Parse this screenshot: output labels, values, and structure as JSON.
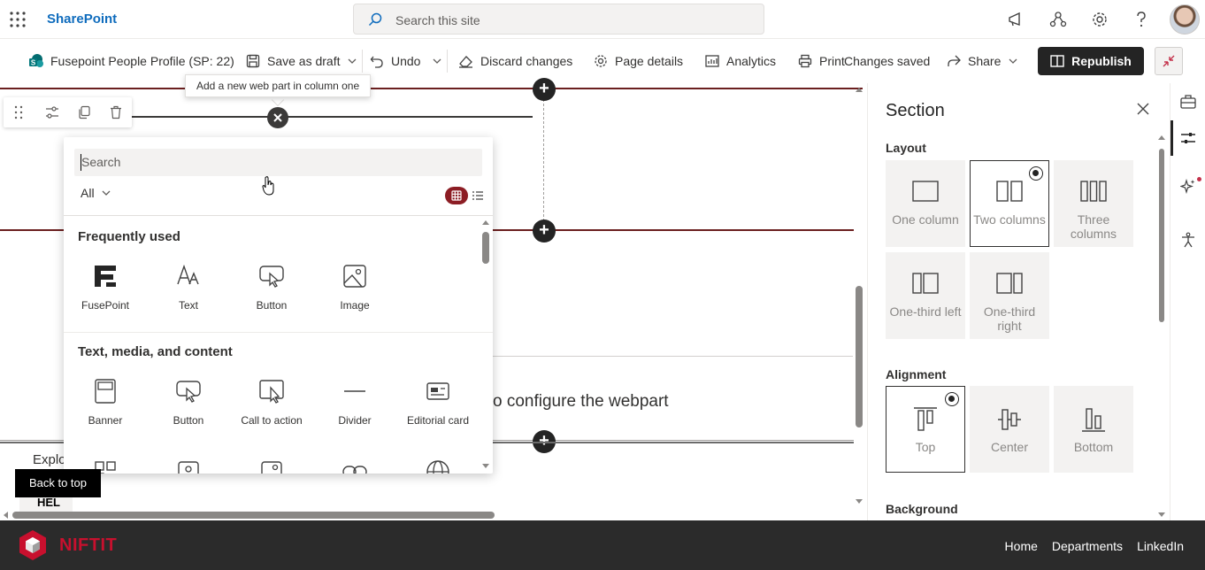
{
  "suite": {
    "brand": "SharePoint",
    "search_placeholder": "Search this site"
  },
  "commands": {
    "page_name": "Fusepoint People Profile (SP: 22)",
    "save_draft": "Save as draft",
    "undo": "Undo",
    "discard": "Discard changes",
    "page_details": "Page details",
    "analytics": "Analytics",
    "print": "Print",
    "status": "Changes saved",
    "share": "Share",
    "republish": "Republish"
  },
  "canvas": {
    "tooltip": "Add a new web part in column one",
    "configure_text": "o configure the webpart",
    "explore_text": "Explo",
    "help_text": "HEL",
    "back_to_top": "Back to top"
  },
  "picker": {
    "search_placeholder": "Search",
    "filter": "All",
    "categories": [
      {
        "title": "Frequently used",
        "items": [
          {
            "label": "FusePoint",
            "icon": "fusepoint-logo-icon"
          },
          {
            "label": "Text",
            "icon": "text-icon"
          },
          {
            "label": "Button",
            "icon": "button-icon"
          },
          {
            "label": "Image",
            "icon": "image-icon"
          }
        ]
      },
      {
        "title": "Text, media, and content",
        "items": [
          {
            "label": "Banner",
            "icon": "banner-icon"
          },
          {
            "label": "Button",
            "icon": "button-icon"
          },
          {
            "label": "Call to action",
            "icon": "call-to-action-icon"
          },
          {
            "label": "Divider",
            "icon": "divider-icon"
          },
          {
            "label": "Editorial card",
            "icon": "editorial-card-icon"
          }
        ]
      }
    ]
  },
  "pane": {
    "title": "Section",
    "layout_label": "Layout",
    "layouts": [
      {
        "label": "One column",
        "selected": false
      },
      {
        "label": "Two columns",
        "selected": true
      },
      {
        "label": "Three columns",
        "selected": false
      },
      {
        "label": "One-third left",
        "selected": false
      },
      {
        "label": "One-third right",
        "selected": false
      }
    ],
    "alignment_label": "Alignment",
    "alignments": [
      {
        "label": "Top",
        "selected": true
      },
      {
        "label": "Center",
        "selected": false
      },
      {
        "label": "Bottom",
        "selected": false
      }
    ],
    "background_label": "Background"
  },
  "footer": {
    "logo_main": "NIFT",
    "logo_accent": "IT",
    "links": [
      "Home",
      "Departments",
      "LinkedIn"
    ]
  },
  "colors": {
    "brand_blue": "#0f6cbd",
    "section_line": "#6b1f1f",
    "accent_red": "#8c1d24",
    "footer_bg": "#2b2b2b"
  }
}
